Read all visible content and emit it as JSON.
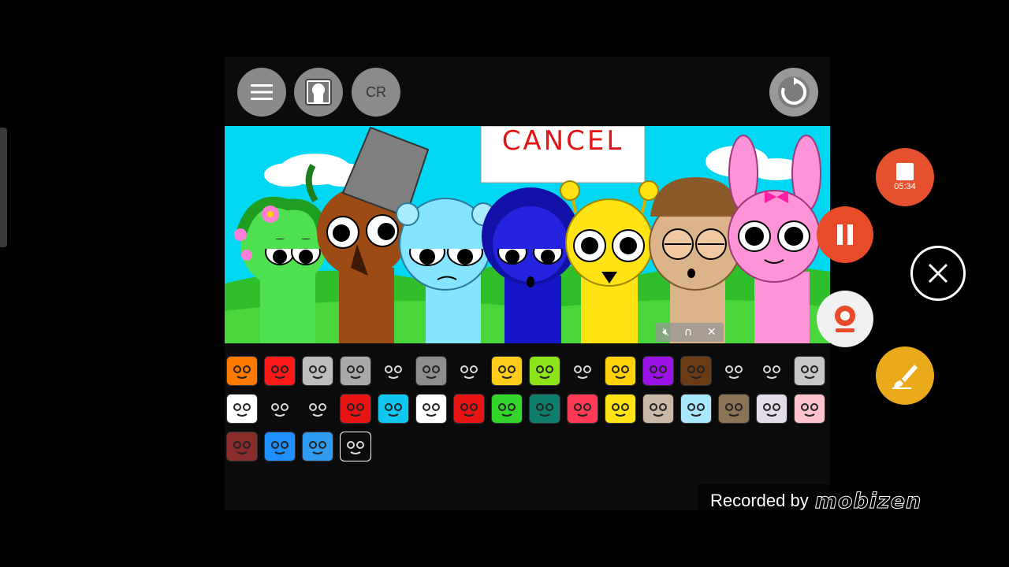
{
  "toolbar": {
    "menu_icon": "hamburger-menu-icon",
    "character_icon": "character-card-icon",
    "cr_label": "CR",
    "reset_icon": "reset-refresh-icon"
  },
  "scene": {
    "sign_text": "CANCEL",
    "background": {
      "sky": "#00d7f3",
      "grass": "#2fbf2a",
      "cloud": "#ffffff"
    },
    "characters": [
      {
        "name": "green-flower-sprunki",
        "color": "#4fe051"
      },
      {
        "name": "brown-bucket-sprunki",
        "color": "#9b4b13"
      },
      {
        "name": "light-blue-bear-sprunki",
        "color": "#85e4ff"
      },
      {
        "name": "dark-blue-hooded-sprunki",
        "color": "#1515c8"
      },
      {
        "name": "yellow-antenna-sprunki",
        "color": "#ffe314"
      },
      {
        "name": "tan-cap-sprunki",
        "color": "#dcb48a"
      },
      {
        "name": "pink-bunny-sprunki",
        "color": "#ff93d7"
      }
    ]
  },
  "floating_controls": {
    "mute_icon": "mute-icon",
    "headphone_icon": "headphones-icon",
    "close_icon": "close-icon"
  },
  "palette": [
    {
      "icon": "orange-face-icon",
      "color": "#ff7a00"
    },
    {
      "icon": "red-spiky-icon",
      "color": "#ff1a1a"
    },
    {
      "icon": "silver-ufo-icon",
      "color": "#bdbdbd"
    },
    {
      "icon": "tv-robot-icon",
      "color": "#a9a9a9"
    },
    {
      "icon": "flower-spider-icon",
      "color": "#0b0b0b"
    },
    {
      "icon": "gray-cat-icon",
      "color": "#8d8d8d"
    },
    {
      "icon": "gray-block-icon",
      "color": "#0b0b0b"
    },
    {
      "icon": "yellow-visor-icon",
      "color": "#ffcc1c"
    },
    {
      "icon": "lime-spiky-icon",
      "color": "#8be51a"
    },
    {
      "icon": "frog-eyes-icon",
      "color": "#0b0b0b"
    },
    {
      "icon": "sun-icon",
      "color": "#ffd20a"
    },
    {
      "icon": "purple-horns-icon",
      "color": "#9a12e8"
    },
    {
      "icon": "tree-icon",
      "color": "#6b3b13"
    },
    {
      "icon": "crab-icon",
      "color": "#0b0b0b"
    },
    {
      "icon": "gray-hat-icon",
      "color": "#0b0b0b"
    },
    {
      "icon": "monitor-icon",
      "color": "#c7c7c7"
    },
    {
      "icon": "white-envelope-icon",
      "color": "#ffffff"
    },
    {
      "icon": "white-bunny-icon",
      "color": "#0b0b0b"
    },
    {
      "icon": "black-orb-icon",
      "color": "#0b0b0b"
    },
    {
      "icon": "red-headphones-icon",
      "color": "#e81414"
    },
    {
      "icon": "blue-jellyfish-icon",
      "color": "#12c7ef"
    },
    {
      "icon": "crying-face-icon",
      "color": "#ffffff"
    },
    {
      "icon": "mushroom-icon",
      "color": "#e81414"
    },
    {
      "icon": "green-frog-icon",
      "color": "#32d62a"
    },
    {
      "icon": "teal-face-icon",
      "color": "#0f7d6b"
    },
    {
      "icon": "red-bird-icon",
      "color": "#ff3a55"
    },
    {
      "icon": "yellow-cat-icon",
      "color": "#ffe314"
    },
    {
      "icon": "beige-castle-icon",
      "color": "#c9b8a5"
    },
    {
      "icon": "light-blue-face-icon",
      "color": "#a9e7ff"
    },
    {
      "icon": "brown-bandage-icon",
      "color": "#8b7355"
    },
    {
      "icon": "moon-icon",
      "color": "#e3dbe8"
    },
    {
      "icon": "pink-face-icon",
      "color": "#ffc3cf"
    },
    {
      "icon": "maroon-arch-icon",
      "color": "#8b2c2c"
    },
    {
      "icon": "peace-sign-icon",
      "color": "#1e90ff"
    },
    {
      "icon": "blue-cape-icon",
      "color": "#2f9cf2"
    },
    {
      "icon": "black-hat-icon",
      "color": "#0b0b0b"
    }
  ],
  "recorder": {
    "stop_icon": "stop-icon",
    "timer": "05:34",
    "pause_icon": "pause-icon",
    "close_icon": "close-icon",
    "camera_icon": "webcam-icon",
    "brush_icon": "brush-icon",
    "watermark_text": "Recorded by",
    "watermark_brand": "mobizen"
  }
}
